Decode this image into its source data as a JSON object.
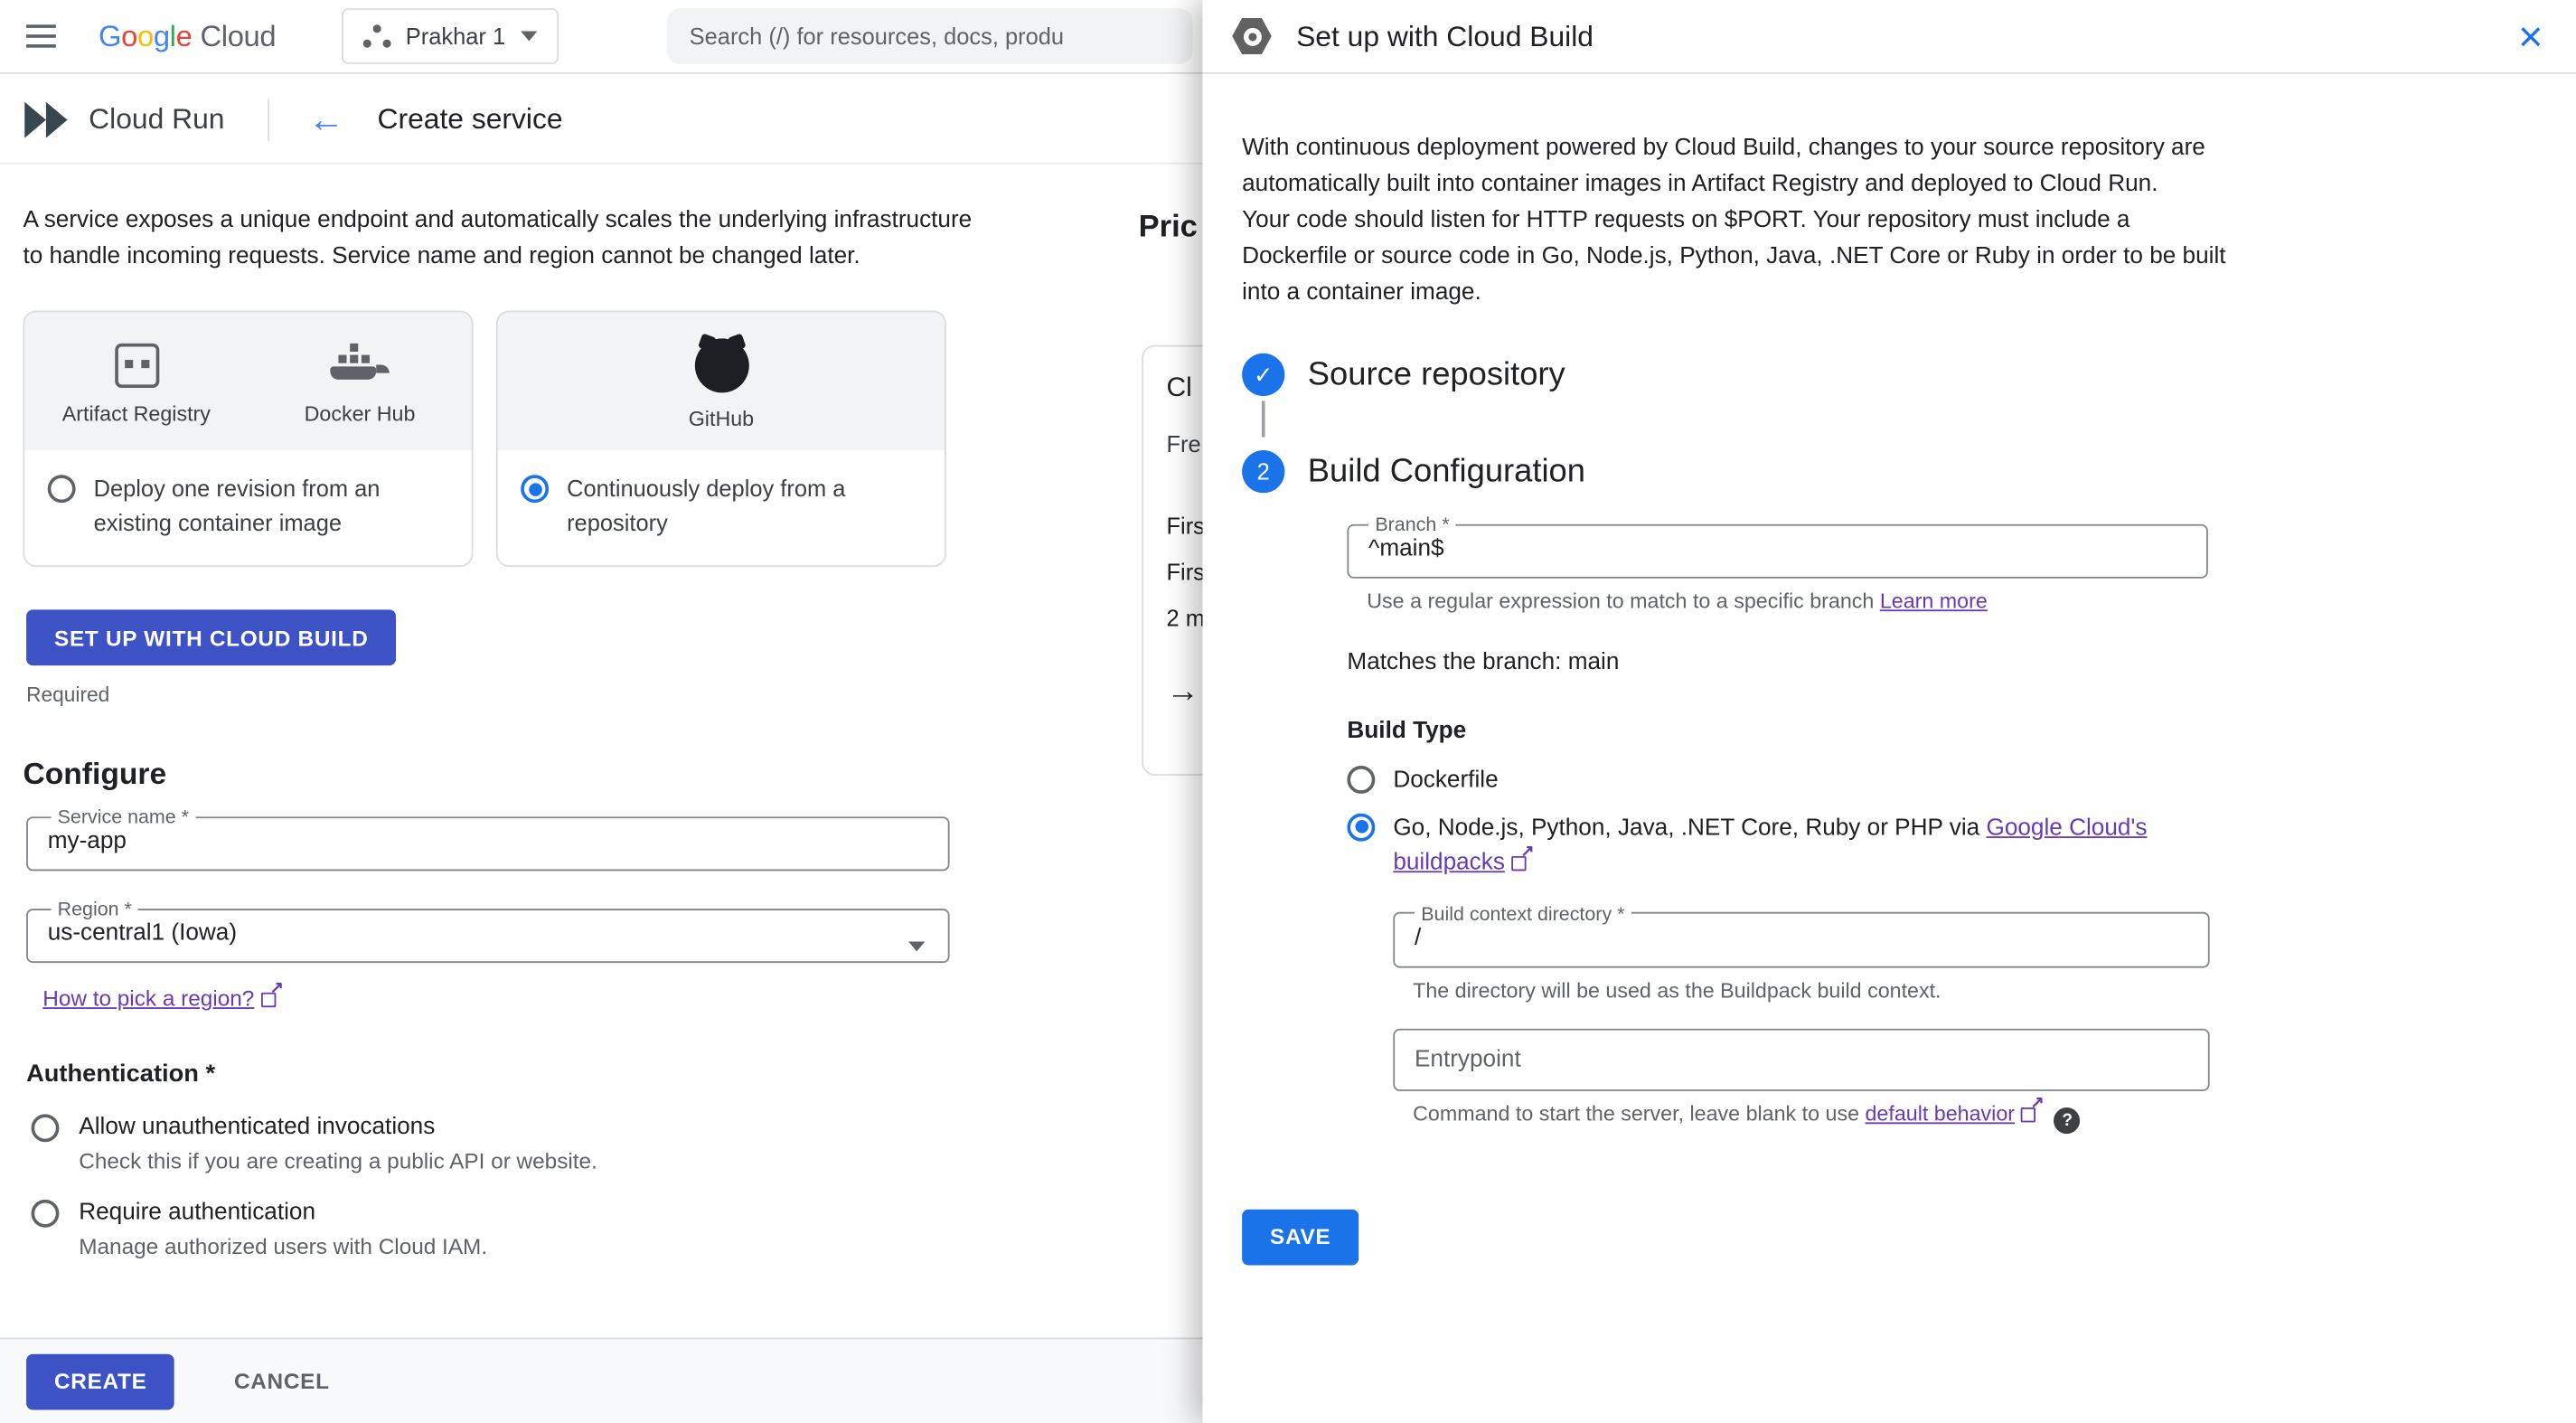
{
  "colors": {
    "primary_blue": "#1a73e8",
    "action_button_indigo": "#3d52c5",
    "link_purple": "#673ab7",
    "text_primary": "#202124",
    "text_secondary": "#5f6368",
    "border_gray": "#dadce0"
  },
  "topbar": {
    "logo": {
      "letters": [
        {
          "ch": "G"
        },
        {
          "ch": "o"
        },
        {
          "ch": "o"
        },
        {
          "ch": "g"
        },
        {
          "ch": "l"
        },
        {
          "ch": "e"
        }
      ],
      "cloud": "Cloud"
    },
    "project_selector": {
      "label": "Prakhar 1"
    },
    "search": {
      "placeholder": "Search (/) for resources, docs, produ"
    }
  },
  "subheader": {
    "product": "Cloud Run",
    "back_icon": "←",
    "title": "Create service"
  },
  "main": {
    "intro": "A service exposes a unique endpoint and automatically scales the underlying infrastructure to handle incoming requests. Service name and region cannot be changed later.",
    "source_cards": [
      {
        "providers": [
          {
            "name": "Artifact Registry"
          },
          {
            "name": "Docker Hub"
          }
        ],
        "option": "Deploy one revision from an existing container image",
        "selected": false
      },
      {
        "providers": [
          {
            "name": "GitHub"
          }
        ],
        "option": "Continuously deploy from a repository",
        "selected": true
      }
    ],
    "setup_button": "SET UP WITH CLOUD BUILD",
    "required_label": "Required",
    "configure": {
      "heading": "Configure",
      "service_name": {
        "label": "Service name *",
        "value": "my-app"
      },
      "region": {
        "label": "Region *",
        "value": "us-central1 (Iowa)"
      },
      "region_link": "How to pick a region?"
    },
    "authentication": {
      "heading": "Authentication *",
      "options": [
        {
          "label": "Allow unauthenticated invocations",
          "description": "Check this if you are creating a public API or website.",
          "selected": false
        },
        {
          "label": "Require authentication",
          "description": "Manage authorized users with Cloud IAM.",
          "selected": false
        }
      ]
    },
    "footer": {
      "create": "CREATE",
      "cancel": "CANCEL"
    }
  },
  "pricing": {
    "heading": "Pric",
    "card_title": "Cl",
    "card_subtitle": "Fre",
    "lines": [
      "Firs",
      "Firs",
      "2 m"
    ],
    "arrow": "→"
  },
  "panel": {
    "title": "Set up with Cloud Build",
    "close_icon": "×",
    "intro_p1": "With continuous deployment powered by Cloud Build, changes to your source repository are automatically built into container images in Artifact Registry and deployed to Cloud Run.",
    "intro_p2": "Your code should listen for HTTP requests on $PORT. Your repository must include a Dockerfile or source code in Go, Node.js, Python, Java, .NET Core or Ruby in order to be built into a container image.",
    "steps": [
      {
        "icon": "✓",
        "label": "Source repository"
      },
      {
        "number": "2",
        "label": "Build Configuration"
      }
    ],
    "branch_field": {
      "label": "Branch *",
      "value": "^main$",
      "helper": "Use a regular expression to match to a specific branch ",
      "helper_link": "Learn more"
    },
    "match_text": "Matches the branch: main",
    "build_type": {
      "label": "Build Type",
      "options": [
        {
          "label": "Dockerfile",
          "selected": false
        },
        {
          "label_prefix": "Go, Node.js, Python, Java, .NET Core, Ruby or PHP via ",
          "label_link": "Google Cloud's buildpacks",
          "selected": true
        }
      ]
    },
    "build_context_field": {
      "label": "Build context directory *",
      "value": "/",
      "helper": "The directory will be used as the Buildpack build context."
    },
    "entrypoint_field": {
      "label": "Entrypoint",
      "helper": "Command to start the server, leave blank to use ",
      "helper_link": "default behavior",
      "help_icon": "?"
    },
    "save_button": "SAVE"
  }
}
